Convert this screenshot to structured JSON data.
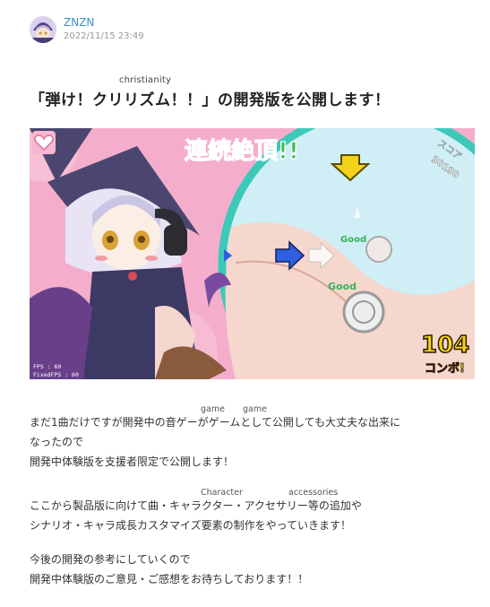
{
  "author": {
    "name": "ZNZN",
    "date": "2022/11/15 23:49"
  },
  "post": {
    "title_ruby": "christianity",
    "title": "「弾け！クリリズム！！」の開発版を公開します！"
  },
  "game_screen": {
    "banner": "連続絶頂!!",
    "good_1": "Good",
    "good_2": "Good",
    "fps_1": "FPS : 60",
    "fps_2": "FixedFPS : 60",
    "combo_count": "104",
    "combo_label": "コンボ!",
    "score_label": "スコア",
    "score_value": "30190"
  },
  "body": {
    "p1_ruby_1": "game",
    "p1_ruby_2": "game",
    "p1_line1": "まだ1曲だけですが開発中の音ゲーがゲームとして公開しても大丈夫な出来に",
    "p1_line2": "なったので",
    "p1_line3": "開発中体験版を支援者限定で公開します！",
    "p2_ruby_1": "Character",
    "p2_ruby_2": "accessories",
    "p2_line1": "ここから製品版に向けて曲・キャラクター・アクセサリー等の追加や",
    "p2_line2": "シナリオ・キャラ成長カスタマイズ要素の制作をやっていきます！",
    "p3_line1": "今後の開発の参考にしていくので",
    "p3_line2": "開発中体験版のご意見・ご感想をお待ちしております！！"
  },
  "colors": {
    "link": "#3a92c7",
    "banner_green": "#3fbf4f",
    "ring_teal": "#3cc9b8",
    "arrow_blue": "#2f5fe0",
    "arrow_yellow": "#f2d21a"
  }
}
